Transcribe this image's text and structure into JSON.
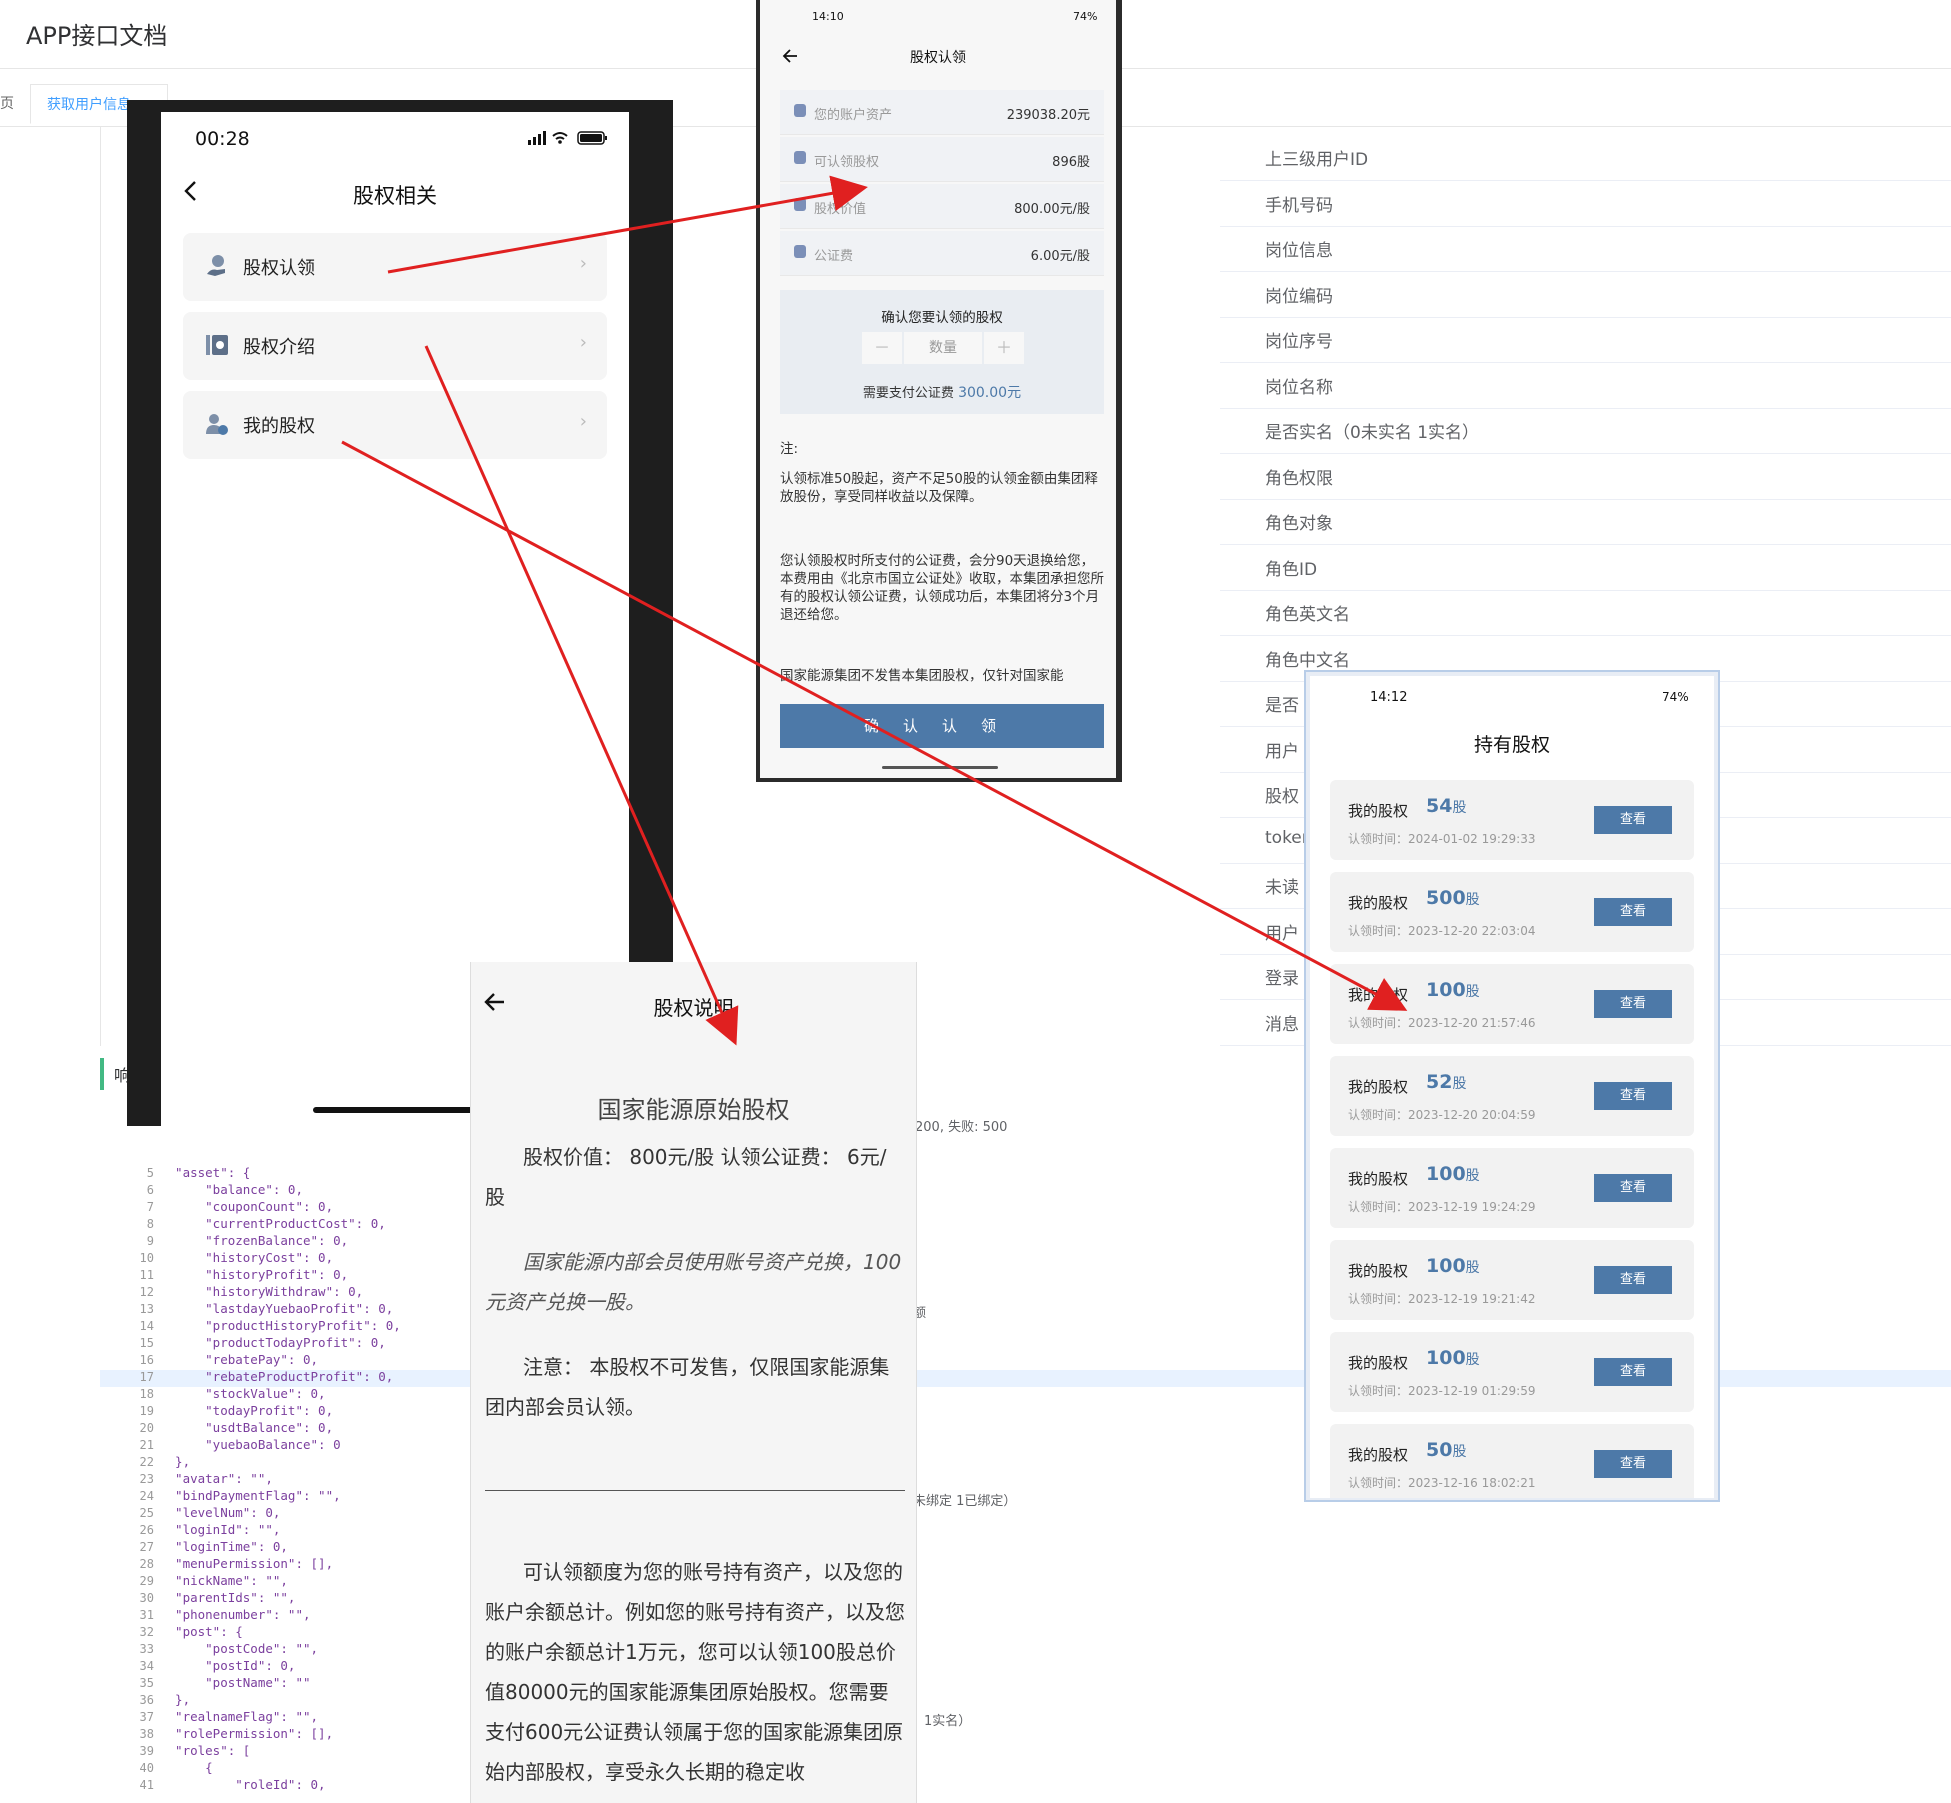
{
  "doc": {
    "title": "APP接口文档",
    "tab_prev": "页",
    "tab_active": "获取用户信息",
    "tab_close": "×",
    "fields": [
      "上三级用户ID",
      "手机号码",
      "岗位信息",
      "岗位编码",
      "岗位序号",
      "岗位名称",
      "是否实名（0未实名 1实名）",
      "角色权限",
      "角色对象",
      "角色ID",
      "角色英文名",
      "角色中文名",
      "是否",
      "用户",
      "股权",
      "token",
      "未读",
      "用户",
      "登录",
      "消息"
    ],
    "response_label": "响",
    "side_notes": {
      "status_codes": "200, 失败: 500",
      "frag_amount": "额",
      "bind_flag": "未绑定 1已绑定）",
      "realname_flag": "1实名）"
    },
    "code_lines": [
      {
        "n": "5",
        "t": "  \"asset\": {"
      },
      {
        "n": "6",
        "t": "      \"balance\": 0,"
      },
      {
        "n": "7",
        "t": "      \"couponCount\": 0,"
      },
      {
        "n": "8",
        "t": "      \"currentProductCost\": 0,"
      },
      {
        "n": "9",
        "t": "      \"frozenBalance\": 0,"
      },
      {
        "n": "10",
        "t": "      \"historyCost\": 0,"
      },
      {
        "n": "11",
        "t": "      \"historyProfit\": 0,"
      },
      {
        "n": "12",
        "t": "      \"historyWithdraw\": 0,"
      },
      {
        "n": "13",
        "t": "      \"lastdayYuebaoProfit\": 0,"
      },
      {
        "n": "14",
        "t": "      \"productHistoryProfit\": 0,"
      },
      {
        "n": "15",
        "t": "      \"productTodayProfit\": 0,"
      },
      {
        "n": "16",
        "t": "      \"rebatePay\": 0,"
      },
      {
        "n": "17",
        "t": "      \"rebateProductProfit\": 0,"
      },
      {
        "n": "18",
        "t": "      \"stockValue\": 0,"
      },
      {
        "n": "19",
        "t": "      \"todayProfit\": 0,"
      },
      {
        "n": "20",
        "t": "      \"usdtBalance\": 0,"
      },
      {
        "n": "21",
        "t": "      \"yuebaoBalance\": 0"
      },
      {
        "n": "22",
        "t": "  },"
      },
      {
        "n": "23",
        "t": "  \"avatar\": \"\","
      },
      {
        "n": "24",
        "t": "  \"bindPaymentFlag\": \"\","
      },
      {
        "n": "25",
        "t": "  \"levelNum\": 0,"
      },
      {
        "n": "26",
        "t": "  \"loginId\": \"\","
      },
      {
        "n": "27",
        "t": "  \"loginTime\": 0,"
      },
      {
        "n": "28",
        "t": "  \"menuPermission\": [],"
      },
      {
        "n": "29",
        "t": "  \"nickName\": \"\","
      },
      {
        "n": "30",
        "t": "  \"parentIds\": \"\","
      },
      {
        "n": "31",
        "t": "  \"phonenumber\": \"\","
      },
      {
        "n": "32",
        "t": "  \"post\": {"
      },
      {
        "n": "33",
        "t": "      \"postCode\": \"\","
      },
      {
        "n": "34",
        "t": "      \"postId\": 0,"
      },
      {
        "n": "35",
        "t": "      \"postName\": \"\""
      },
      {
        "n": "36",
        "t": "  },"
      },
      {
        "n": "37",
        "t": "  \"realnameFlag\": \"\","
      },
      {
        "n": "38",
        "t": "  \"rolePermission\": [],"
      },
      {
        "n": "39",
        "t": "  \"roles\": ["
      },
      {
        "n": "40",
        "t": "      {"
      },
      {
        "n": "41",
        "t": "          \"roleId\": 0,"
      }
    ]
  },
  "phone_menu": {
    "time": "00:28",
    "title": "股权相关",
    "items": [
      {
        "label": "股权认领",
        "icon": "hand-coin-icon"
      },
      {
        "label": "股权介绍",
        "icon": "report-icon"
      },
      {
        "label": "我的股权",
        "icon": "user-share-icon"
      }
    ]
  },
  "phone_claim": {
    "time": "14:10",
    "battery": "74%",
    "title": "股权认领",
    "rows": [
      {
        "label": "您的账户资产",
        "value": "239038.20元"
      },
      {
        "label": "可认领股权",
        "value": "896股"
      },
      {
        "label": "股权价值",
        "value": "800.00元/股"
      },
      {
        "label": "公证费",
        "value": "6.00元/股"
      }
    ],
    "confirm_title": "确认您要认领的股权",
    "qty_minus": "－",
    "qty_placeholder": "数量",
    "qty_plus": "＋",
    "fee_prefix": "需要支付公证费",
    "fee_value": "300.00元",
    "note_title": "注:",
    "note_1": "认领标准50股起，资产不足50股的认领金额由集团释放股份，享受同样收益以及保障。",
    "note_2": "您认领股权时所支付的公证费，会分90天退换给您，本费用由《北京市国立公证处》收取，本集团承担您所有的股权认领公证费，认领成功后，本集团将分3个月退还给您。",
    "note_3": "国家能源集团不发售本集团股权，仅针对国家能",
    "button": "确认认领"
  },
  "phone_holdings": {
    "time": "14:12",
    "battery": "74%",
    "title": "持有股权",
    "item_label": "我的股权",
    "unit": "股",
    "time_label": "认领时间：",
    "button": "查看",
    "items": [
      {
        "amount": "54",
        "time": "2024-01-02 19:29:33"
      },
      {
        "amount": "500",
        "time": "2023-12-20 22:03:04"
      },
      {
        "amount": "100",
        "time": "2023-12-20 21:57:46"
      },
      {
        "amount": "52",
        "time": "2023-12-20 20:04:59"
      },
      {
        "amount": "100",
        "time": "2023-12-19 19:24:29"
      },
      {
        "amount": "100",
        "time": "2023-12-19 19:21:42"
      },
      {
        "amount": "100",
        "time": "2023-12-19 01:29:59"
      },
      {
        "amount": "50",
        "time": "2023-12-16 18:02:21"
      }
    ]
  },
  "phone_intro": {
    "title": "股权说明",
    "heading": "国家能源原始股权",
    "value_line": "股权价值：  800元/股  认领公证费：  6元/股",
    "italic_line": "国家能源内部会员使用账号资产兑换，100元资产兑换一股。",
    "notice": "注意：  本股权不可发售，仅限国家能源集团内部会员认领。",
    "body": "可认领额度为您的账号持有资产，以及您的账户余额总计。例如您的账号持有资产，以及您的账户余额总计1万元，您可以认领100股总价值80000元的国家能源集团原始股权。您需要支付600元公证费认领属于您的国家能源集团原始内部股权，享受永久长期的稳定收"
  },
  "colors": {
    "accent": "#4d79a8",
    "arrow": "#e02020",
    "link": "#409eff"
  }
}
